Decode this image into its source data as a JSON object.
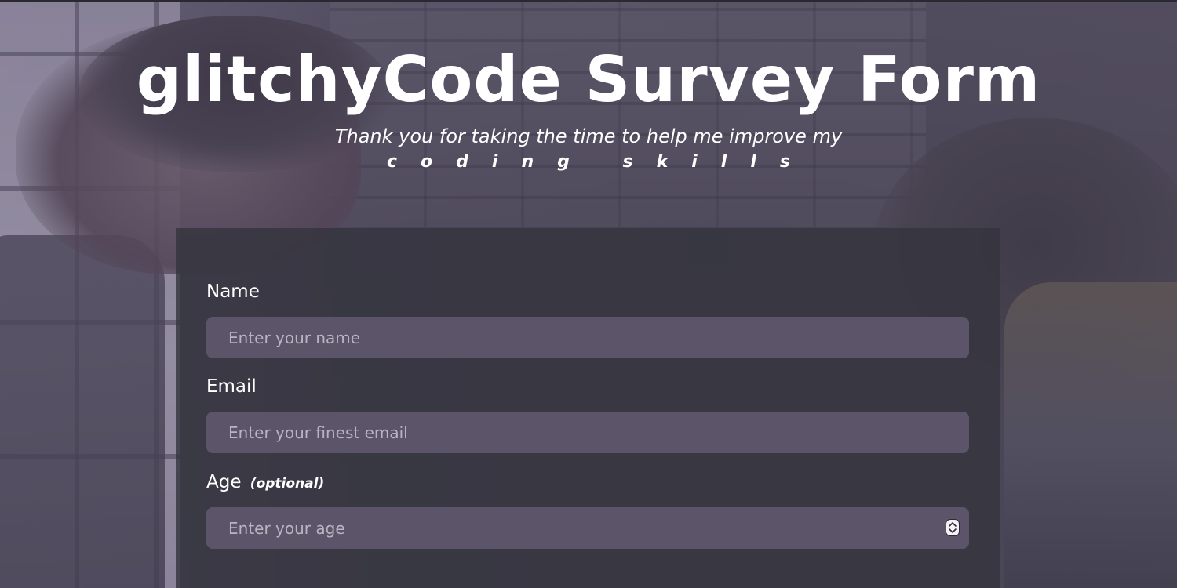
{
  "header": {
    "title": "glitchyCode Survey Form",
    "description": "Thank you for taking the time to help me improve my",
    "description_emphasis": "coding skills"
  },
  "form": {
    "name": {
      "label": "Name",
      "placeholder": "Enter your name"
    },
    "email": {
      "label": "Email",
      "placeholder": "Enter your finest email"
    },
    "age": {
      "label": "Age",
      "label_note": "(optional)",
      "placeholder": "Enter your age"
    }
  },
  "colors": {
    "panel": "#34343e",
    "input_background": "#5c5569",
    "text": "#ffffff",
    "placeholder": "#b9b4c2"
  },
  "icons": {
    "age_spinner": "stepper-arrows-icon"
  }
}
